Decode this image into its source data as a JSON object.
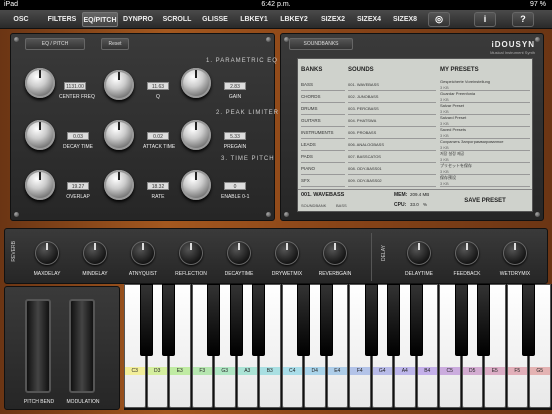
{
  "status": {
    "device": "iPad",
    "time": "6:42 p.m.",
    "battery": "97 %"
  },
  "toolbar": {
    "tabs": [
      "OSC",
      "FILTERS",
      "EQ/PITCH",
      "DYNPRO",
      "SCROLL",
      "GLISSE",
      "LBKEY1",
      "LBKEY2",
      "SIZEX2",
      "SIZEX4",
      "SIZEX8"
    ],
    "icons": [
      "globe-icon",
      "info-icon",
      "help-icon"
    ]
  },
  "eq": {
    "tab": "EQ / PITCH",
    "reset": "Reset",
    "sec1": "1. PARAMETRIC EQ",
    "sec2": "2. PEAK LIMITER",
    "sec3": "3. TIME PITCH",
    "center_val": "1131.00",
    "center": "CENTER FREQ",
    "q_val": "11.63",
    "q": "Q",
    "gain_val": "2.83",
    "gain": "GAIN",
    "decay_val": "0.03",
    "decay": "DECAY TIME",
    "attack_val": "0.02",
    "attack": "ATTACK TIME",
    "pregain_val": "5.33",
    "pregain": "PREGAIN",
    "overlap_val": "19.27",
    "overlap": "OVERLAP",
    "rate_val": "18.32",
    "rate": "RATE",
    "enable_val": "0",
    "enable": "ENABLE 0-1"
  },
  "soundbanks": {
    "tab": "SOUNDBANKS",
    "logo": "iDOUSYN",
    "logo_sub": "Musical Instrument Synth"
  },
  "screen": {
    "banks_h": "BANKS",
    "sounds_h": "SOUNDS",
    "presets_h": "MY PRESETS",
    "banks": [
      "BASS",
      "CHORDS",
      "DRUMS",
      "GUITARS",
      "INSTRUMENTS",
      "LEADS",
      "PADS",
      "PIANO",
      "SFX"
    ],
    "sounds": [
      "001. WAVEBASS",
      "002. JUNOBASS",
      "003. PERCBASS",
      "004. PHATSWA",
      "005. PROBASS",
      "006. ANALOGBASS",
      "007. BASSCATOS",
      "008. ODY-BASS01",
      "009. ODY-BASS02"
    ],
    "presets": [
      {
        "n": "Gespeicherte Voreinstellung",
        "s": "3 KB"
      },
      {
        "n": "Guardar Preenfonia",
        "s": "3 KB"
      },
      {
        "n": "Salvar Preset",
        "s": "3 KB"
      },
      {
        "n": "Salvard Preset",
        "s": "3 KB"
      },
      {
        "n": "Saved Presets",
        "s": "3 KB"
      },
      {
        "n": "Сохранить Запрограммированное",
        "s": "3 KB"
      },
      {
        "n": "저장 설정 제공",
        "s": "3 KB"
      },
      {
        "n": "プリセットを保存",
        "s": "3 KB"
      },
      {
        "n": "保存预设",
        "s": "3 KB"
      }
    ],
    "current": "001. WAVEBASS",
    "mem_l": "MEM:",
    "mem": "209.4 MB",
    "cpu_l": "CPU:",
    "cpu": "33.0",
    "cpu_u": "%",
    "soundbank": "SOUNDBANK",
    "bank_sel": "BASS",
    "save": "SAVE PRESET"
  },
  "reverb": {
    "title": "REVERB",
    "knobs": [
      "MAXDELAY",
      "MINDELAY",
      "ATNYQUIST",
      "REFLECTION",
      "DECAYTIME",
      "DRYWETMIX",
      "REVERBGAIN"
    ]
  },
  "delay": {
    "title": "DELAY",
    "knobs": [
      "DELAYTIME",
      "FEEDBACK",
      "WETDRYMIX"
    ]
  },
  "wheels": {
    "pitch": "PITCH BEND",
    "mod": "MODULATION"
  },
  "keys": {
    "labels": [
      "C3",
      "D3",
      "E3",
      "F3",
      "G3",
      "A3",
      "B3",
      "C4",
      "D4",
      "E4",
      "F4",
      "G4",
      "A4",
      "B4",
      "C5",
      "D5",
      "E5",
      "F5",
      "G5"
    ],
    "colors": [
      "#f2ee9a",
      "#d4ee9e",
      "#c0eba3",
      "#b6e6b0",
      "#b0e6c4",
      "#abe3d5",
      "#a9dfe2",
      "#a9dde9",
      "#aad4ea",
      "#aecde8",
      "#b3c3e8",
      "#b8bbe8",
      "#bdb6ea",
      "#c4b0e9",
      "#cbacde",
      "#d3acd1",
      "#dbadc5",
      "#e1afb9",
      "#e4b3b3"
    ]
  }
}
